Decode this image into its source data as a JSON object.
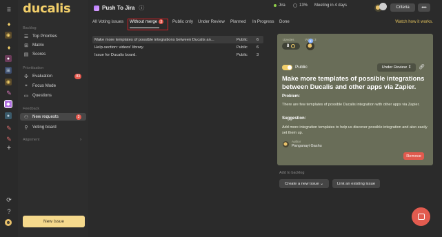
{
  "app": {
    "logo": "ducalis"
  },
  "sidebar": {
    "sections": {
      "backlog": "Backlog",
      "prioritization": "Prioritization",
      "feedback": "Feedback",
      "alignment": "Alignment"
    },
    "items": [
      {
        "label": "Top Priorities",
        "icon": "list-icon"
      },
      {
        "label": "Matrix",
        "icon": "grid-icon"
      },
      {
        "label": "Scores",
        "icon": "table-icon"
      },
      {
        "label": "Evaluation",
        "icon": "compass-icon",
        "badge": "83"
      },
      {
        "label": "Focus Mode",
        "icon": "focus-icon"
      },
      {
        "label": "Questions",
        "icon": "chat-icon"
      },
      {
        "label": "New requests",
        "icon": "users-icon",
        "badge": "3"
      },
      {
        "label": "Voting board",
        "icon": "pin-icon"
      }
    ],
    "new_issue": "New issue"
  },
  "header": {
    "title": "Push To Jira",
    "info": "ⓘ",
    "integration": "Jira",
    "progress": "13%",
    "meeting": "Meeting in 4 days",
    "criteria": "Criteria",
    "more": "•••"
  },
  "tabs": [
    {
      "label": "All Voting issues"
    },
    {
      "label": "Without merge",
      "badge": "3",
      "selected": true
    },
    {
      "label": "Public only"
    },
    {
      "label": "Under Review"
    },
    {
      "label": "Planned"
    },
    {
      "label": "In Progress"
    },
    {
      "label": "Done"
    }
  ],
  "watch_link": "Watch how it works.",
  "issues": [
    {
      "title": "Make more templates of possible integrations between Ducalis an...",
      "visibility": "Public",
      "votes": "6"
    },
    {
      "title": "Help-section: videos' library.",
      "visibility": "Public",
      "votes": "6"
    },
    {
      "title": "Issue for Ducalis board.",
      "visibility": "Public",
      "votes": "3"
    }
  ],
  "detail": {
    "votes_label": "Upvotes",
    "voters_label": "Voters",
    "voters_count": "3",
    "score": "8",
    "public_label": "Public",
    "status": "Under Review ⇕",
    "title": "Make more templates of possible integrations between Ducalis and other apps via Zapier.",
    "problem_h": "Problem:",
    "problem": "There are few templates of possible Ducalis integration with other apps via Zapier.",
    "suggestion_h": "Suggestion:",
    "suggestion": "Add more integration templates to help us discover possible integration and also easily set them up.",
    "author_label": "Author",
    "author_name": "Panganayi Gashu",
    "remove": "Remove"
  },
  "backlog": {
    "label": "Add to backlog",
    "create": "Create a new issue  ⌄",
    "link": "Link an existing issue"
  },
  "colors": {
    "accent": "#f2cf6a",
    "danger": "#e85a4f",
    "panel": "#696d58"
  }
}
